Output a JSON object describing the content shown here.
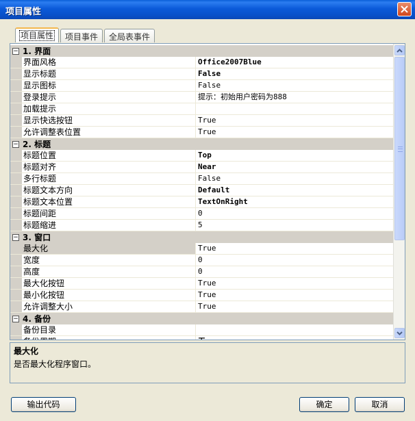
{
  "window": {
    "title": "项目属性"
  },
  "tabs": [
    {
      "label": "项目属性",
      "active": true
    },
    {
      "label": "项目事件",
      "active": false
    },
    {
      "label": "全局表事件",
      "active": false
    }
  ],
  "grid": {
    "categories": [
      {
        "toggle": "⊟",
        "label": "1. 界面",
        "rows": [
          {
            "name": "界面风格",
            "value": "Office2007Blue",
            "bold": true
          },
          {
            "name": "显示标题",
            "value": "False",
            "bold": true
          },
          {
            "name": "显示图标",
            "value": "False",
            "bold": false
          },
          {
            "name": "登录提示",
            "value": "提示：初始用户密码为888",
            "bold": false
          },
          {
            "name": "加载提示",
            "value": "",
            "bold": false
          },
          {
            "name": "显示快选按钮",
            "value": "True",
            "bold": false
          },
          {
            "name": "允许调整表位置",
            "value": "True",
            "bold": false
          }
        ]
      },
      {
        "toggle": "⊟",
        "label": "2. 标题",
        "rows": [
          {
            "name": "标题位置",
            "value": "Top",
            "bold": true
          },
          {
            "name": "标题对齐",
            "value": "Near",
            "bold": true
          },
          {
            "name": "多行标题",
            "value": "False",
            "bold": false
          },
          {
            "name": "标题文本方向",
            "value": "Default",
            "bold": true
          },
          {
            "name": "标题文本位置",
            "value": "TextOnRight",
            "bold": true
          },
          {
            "name": "标题间距",
            "value": "0",
            "bold": false
          },
          {
            "name": "标题缩进",
            "value": "5",
            "bold": false
          }
        ]
      },
      {
        "toggle": "⊟",
        "label": "3. 窗口",
        "rows": [
          {
            "name": "最大化",
            "value": "True",
            "bold": false,
            "selected": true
          },
          {
            "name": "宽度",
            "value": "0",
            "bold": false
          },
          {
            "name": "高度",
            "value": "0",
            "bold": false
          },
          {
            "name": "最大化按钮",
            "value": "True",
            "bold": false
          },
          {
            "name": "最小化按钮",
            "value": "True",
            "bold": false
          },
          {
            "name": "允许调整大小",
            "value": "True",
            "bold": false
          }
        ]
      },
      {
        "toggle": "⊟",
        "label": "4. 备份",
        "rows": [
          {
            "name": "备份目录",
            "value": "",
            "bold": false
          },
          {
            "name": "备份周期",
            "value": "无",
            "bold": true
          }
        ]
      }
    ]
  },
  "description": {
    "title": "最大化",
    "text": "是否最大化程序窗口。"
  },
  "buttons": {
    "export_label": "输出代码",
    "ok_label": "确定",
    "cancel_label": "取消"
  },
  "colors": {
    "titlebar": "#0a5fd8",
    "category_bg": "#d4d0c8",
    "dialog_bg": "#ece9d8"
  }
}
